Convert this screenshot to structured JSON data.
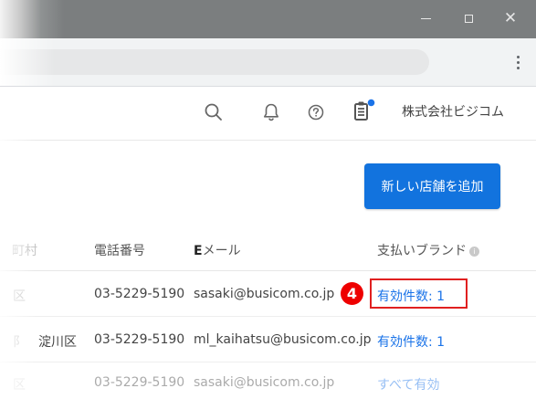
{
  "window": {
    "minimize_glyph": "—",
    "maximize_glyph": "□",
    "close_glyph": "✕"
  },
  "header": {
    "company_name": "株式会社ビジコム",
    "icons": [
      "search-icon",
      "bell-icon",
      "help-icon",
      "clipboard-icon"
    ],
    "notification_dot_color": "#1a73e8"
  },
  "actions": {
    "add_store_label": "新しい店舗を追加",
    "add_store_color": "#1273de"
  },
  "table": {
    "headers": {
      "city": "町村",
      "phone": "電話番号",
      "email_prefix": "E",
      "email_suffix": "メール",
      "brand": "支払いブランド",
      "brand_info": "i"
    },
    "rows": [
      {
        "city": "区",
        "phone": "03-5229-5190",
        "email": "sasaki@busicom.co.jp",
        "brand": "有効件数: 1"
      },
      {
        "city": "淀川区",
        "city_prefix": "阝",
        "phone": "03-5229-5190",
        "email": "ml_kaihatsu@busicom.co.jp",
        "brand": "有効件数: 1"
      },
      {
        "city": "区",
        "phone": "03-5229-5190",
        "email": "sasaki@busicom.co.jp",
        "brand": "すべて有効"
      }
    ]
  },
  "annotation": {
    "step_number": "4",
    "color": "#e02020"
  }
}
